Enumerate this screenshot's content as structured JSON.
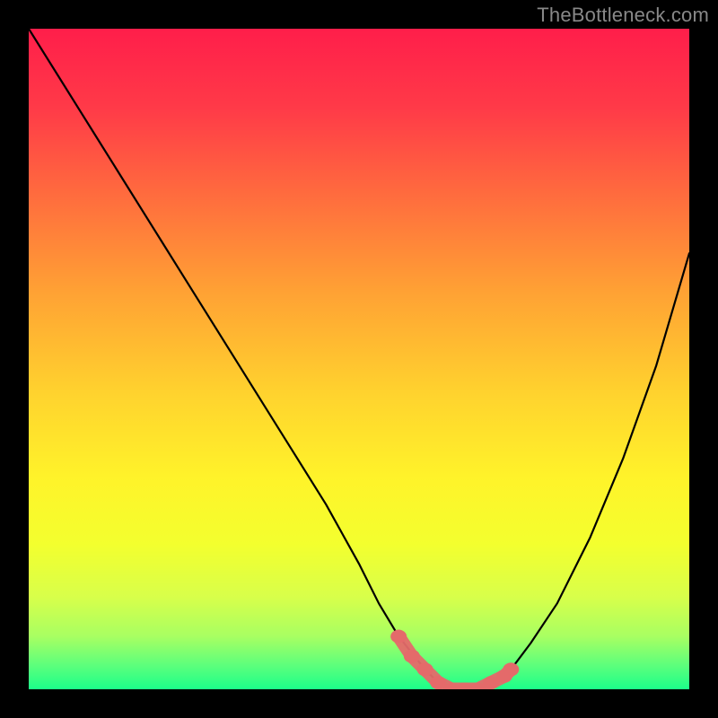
{
  "watermark": "TheBottleneck.com",
  "colors": {
    "frame": "#000000",
    "gradient_stops": [
      {
        "offset": 0.0,
        "color": "#ff1e4a"
      },
      {
        "offset": 0.12,
        "color": "#ff3a48"
      },
      {
        "offset": 0.25,
        "color": "#ff6b3e"
      },
      {
        "offset": 0.4,
        "color": "#ffa234"
      },
      {
        "offset": 0.55,
        "color": "#ffd22e"
      },
      {
        "offset": 0.68,
        "color": "#fff32a"
      },
      {
        "offset": 0.78,
        "color": "#f3ff2e"
      },
      {
        "offset": 0.86,
        "color": "#d8ff4a"
      },
      {
        "offset": 0.92,
        "color": "#a8ff62"
      },
      {
        "offset": 0.96,
        "color": "#63ff7a"
      },
      {
        "offset": 1.0,
        "color": "#1cff8a"
      }
    ],
    "curve": "#000000",
    "marker_fill": "#e46a6a",
    "marker_stroke": "#e46a6a"
  },
  "chart_data": {
    "type": "line",
    "title": "",
    "xlabel": "",
    "ylabel": "",
    "xlim": [
      0,
      100
    ],
    "ylim": [
      0,
      100
    ],
    "series": [
      {
        "name": "bottleneck-curve",
        "x": [
          0,
          5,
          10,
          15,
          20,
          25,
          30,
          35,
          40,
          45,
          50,
          53,
          56,
          60,
          62,
          64,
          66,
          68,
          70,
          73,
          76,
          80,
          85,
          90,
          95,
          100
        ],
        "y": [
          100,
          92,
          84,
          76,
          68,
          60,
          52,
          44,
          36,
          28,
          19,
          13,
          8,
          3,
          1,
          0,
          0,
          0,
          1,
          3,
          7,
          13,
          23,
          35,
          49,
          66
        ]
      }
    ],
    "markers": {
      "name": "highlight-segment",
      "x": [
        56,
        58,
        60,
        62,
        64,
        66,
        68,
        70,
        72,
        73
      ],
      "y": [
        8,
        5,
        3,
        1,
        0,
        0,
        0,
        1,
        2,
        3
      ]
    }
  }
}
